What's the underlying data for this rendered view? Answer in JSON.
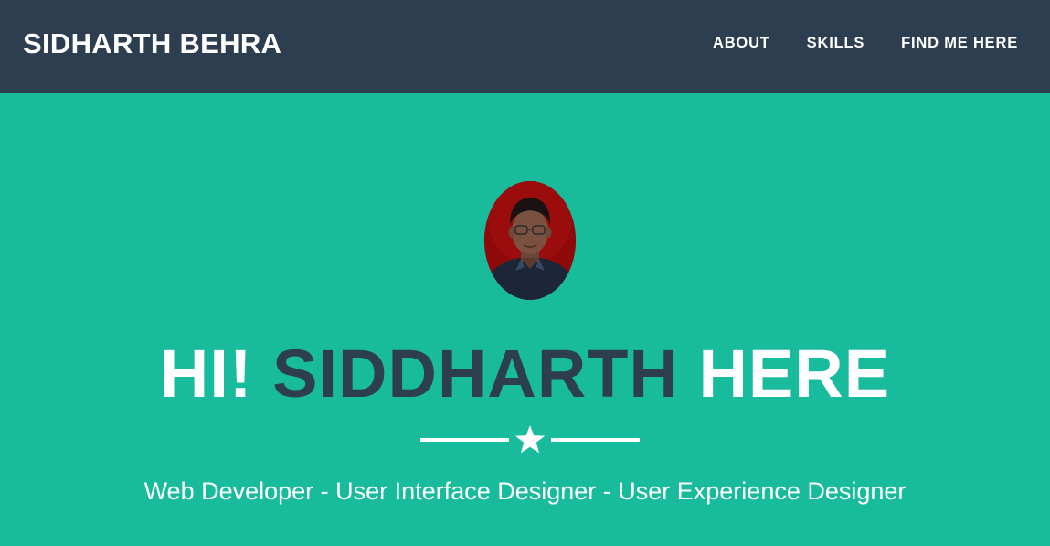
{
  "navbar": {
    "brand": "SIDHARTH BEHRA",
    "links": [
      {
        "label": "ABOUT"
      },
      {
        "label": "SKILLS"
      },
      {
        "label": "FIND ME HERE"
      }
    ]
  },
  "hero": {
    "avatar_icon": "profile-photo",
    "greeting": "HI!",
    "name": "SIDDHARTH",
    "trailing": "HERE",
    "divider_icon": "star-icon",
    "subtitle": "Web Developer - User Interface Designer - User Experience Designer"
  },
  "colors": {
    "navbar_bg": "#2c3e50",
    "hero_bg": "#18bc9c",
    "accent_dark": "#2c3e50",
    "text_light": "#ffffff"
  }
}
